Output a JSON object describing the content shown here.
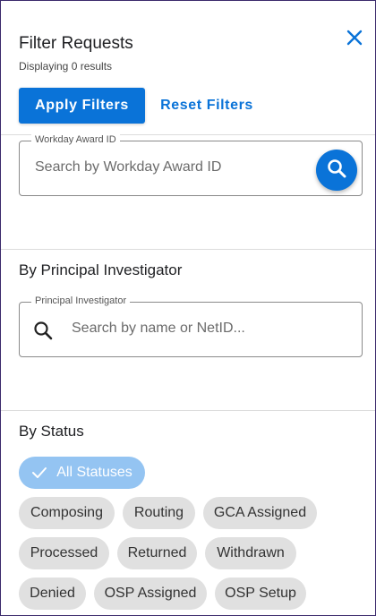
{
  "panel": {
    "title": "Filter Requests",
    "result_summary": "Displaying 0 results",
    "apply_label": "Apply Filters",
    "reset_label": "Reset Filters"
  },
  "award_search": {
    "legend": "Workday Award ID",
    "placeholder": "Search by Workday Award ID"
  },
  "pi_section": {
    "heading": "By Principal Investigator",
    "legend": "Principal Investigator",
    "placeholder": "Search by name or NetID..."
  },
  "status_section": {
    "heading": "By Status",
    "chips": [
      {
        "label": "All Statuses",
        "selected": true
      },
      {
        "label": "Composing",
        "selected": false
      },
      {
        "label": "Routing",
        "selected": false
      },
      {
        "label": "GCA Assigned",
        "selected": false
      },
      {
        "label": "Processed",
        "selected": false
      },
      {
        "label": "Returned",
        "selected": false
      },
      {
        "label": "Withdrawn",
        "selected": false
      },
      {
        "label": "Denied",
        "selected": false
      },
      {
        "label": "OSP Assigned",
        "selected": false
      },
      {
        "label": "OSP Setup",
        "selected": false
      }
    ]
  },
  "colors": {
    "accent": "#0a73d8",
    "chip_selected": "#94c4f2",
    "chip_default": "#e0e0e0"
  },
  "icons": [
    "close-icon",
    "search-icon",
    "check-icon"
  ]
}
